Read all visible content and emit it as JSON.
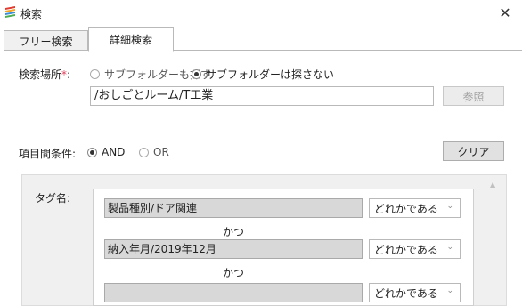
{
  "window": {
    "title": "検索",
    "close_glyph": "✕",
    "icon": "app-logo-icon"
  },
  "tabs": [
    {
      "label": "フリー検索",
      "active": false
    },
    {
      "label": "詳細検索",
      "active": true
    }
  ],
  "search_location": {
    "label": "検索場所",
    "required_mark": "*",
    "colon": ":",
    "options": [
      {
        "label": "サブフォルダーも探す",
        "selected": false
      },
      {
        "label": "サブフォルダーは探さない",
        "selected": true
      }
    ],
    "path": "/おしごとルーム/T工業",
    "browse_label": "参照"
  },
  "item_condition": {
    "label": "項目間条件:",
    "options": [
      {
        "label": "AND",
        "selected": true
      },
      {
        "label": "OR",
        "selected": false
      }
    ],
    "clear_label": "クリア"
  },
  "tags": {
    "label": "タグ名:",
    "rows": [
      {
        "value": "製品種別/ドア関連",
        "match": "どれかである"
      },
      {
        "value": "納入年月/2019年12月",
        "match": "どれかである"
      },
      {
        "value": "",
        "match": "どれかである"
      }
    ],
    "connector": "かつ"
  },
  "colors": {
    "accent_required": "#e0405a",
    "panel_bg": "#f0f0f0",
    "field_bg": "#d8d8d8"
  }
}
